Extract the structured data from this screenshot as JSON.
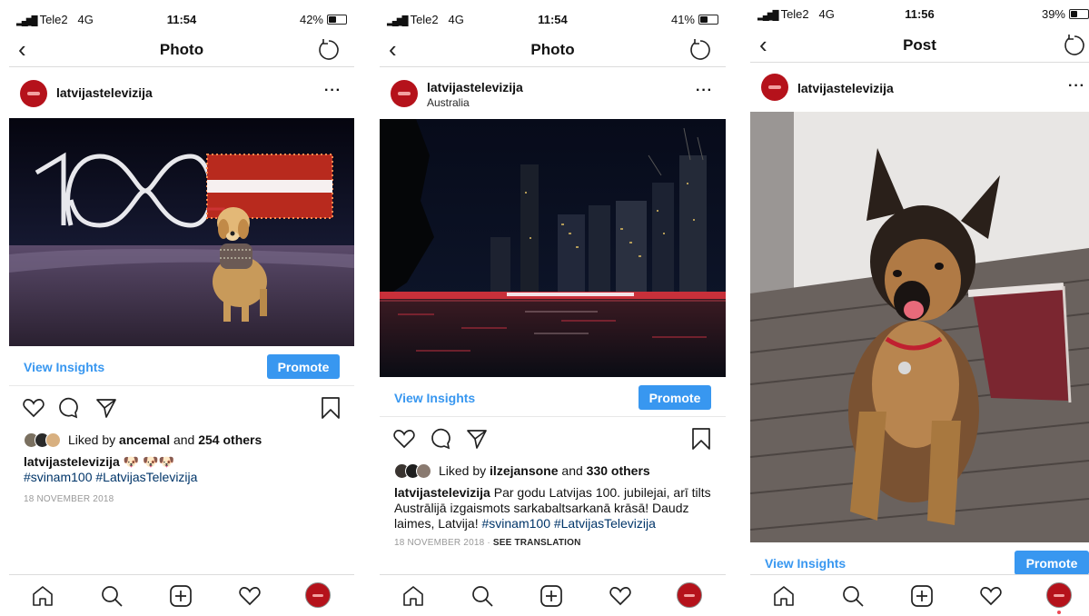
{
  "screens": [
    {
      "status": {
        "carrier": "Tele2",
        "network": "4G",
        "time": "11:54",
        "battery": "42%",
        "battery_level": 0.42
      },
      "nav": {
        "back": "‹",
        "title": "Photo"
      },
      "post": {
        "username": "latvijastelevizija",
        "location": "",
        "more": "···"
      },
      "insights": {
        "view_label": "View Insights",
        "promote_label": "Promote"
      },
      "likes": {
        "prefix": "Liked by ",
        "user": "ancemal",
        "middle": " and ",
        "count": "254 others"
      },
      "caption": {
        "user": "latvijastelevizija",
        "text": " 🐶 🐶🐶",
        "hashtags": "#svinam100 #LatvijasTelevizija"
      },
      "date": "18 NOVEMBER 2018",
      "see_translation": ""
    },
    {
      "status": {
        "carrier": "Tele2",
        "network": "4G",
        "time": "11:54",
        "battery": "41%",
        "battery_level": 0.41
      },
      "nav": {
        "back": "‹",
        "title": "Photo"
      },
      "post": {
        "username": "latvijastelevizija",
        "location": "Australia",
        "more": "···"
      },
      "insights": {
        "view_label": "View Insights",
        "promote_label": "Promote"
      },
      "likes": {
        "prefix": "Liked by ",
        "user": "ilzejansone",
        "middle": " and ",
        "count": "330 others"
      },
      "caption": {
        "user": "latvijastelevizija",
        "text": " Par godu Latvijas 100. jubilejai, arī tilts Austrālijā izgaismots sarkabaltsarkanā krāsā! Daudz laimes, Latvija! ",
        "hashtags": "#svinam100 #LatvijasTelevizija"
      },
      "date": "18 NOVEMBER 2018",
      "separator": " · ",
      "see_translation": "SEE TRANSLATION"
    },
    {
      "status": {
        "carrier": "Tele2",
        "network": "4G",
        "time": "11:56",
        "battery": "39%",
        "battery_level": 0.39
      },
      "nav": {
        "back": "‹",
        "title": "Post"
      },
      "post": {
        "username": "latvijastelevizija",
        "location": "",
        "more": "···"
      },
      "insights": {
        "view_label": "View Insights",
        "promote_label": "Promote"
      }
    }
  ],
  "icons": {
    "heart": "heart-icon",
    "comment": "comment-icon",
    "share": "direct-share-icon",
    "save": "bookmark-icon",
    "home": "home-icon",
    "search": "search-icon",
    "add": "add-post-icon",
    "activity": "activity-heart-icon",
    "refresh": "refresh-icon",
    "back": "back-chevron-icon"
  },
  "colors": {
    "accent": "#3897f0",
    "brand_red": "#b5121b",
    "hashtag": "#003569",
    "muted": "#999999"
  }
}
